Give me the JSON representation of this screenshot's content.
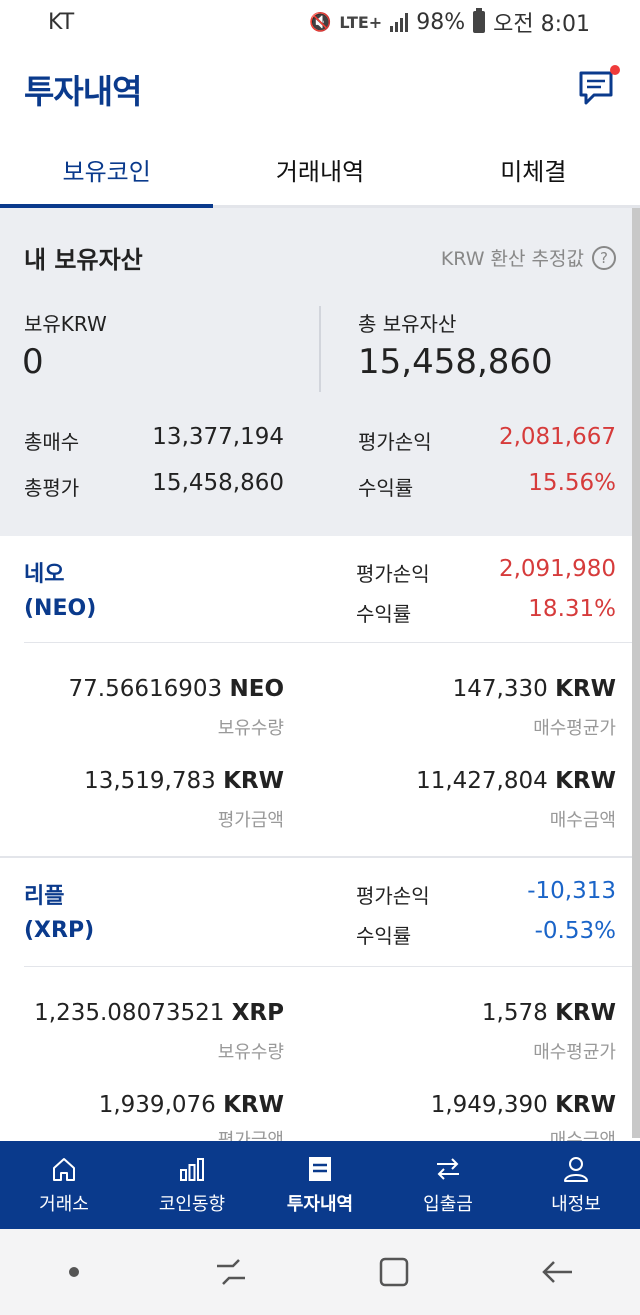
{
  "status": {
    "carrier": "KT",
    "network": "LTE+",
    "battery": "98%",
    "time": "오전 8:01"
  },
  "header": {
    "title": "투자내역"
  },
  "tabs": [
    {
      "label": "보유코인",
      "active": true
    },
    {
      "label": "거래내역",
      "active": false
    },
    {
      "label": "미체결",
      "active": false
    }
  ],
  "summary": {
    "title": "내 보유자산",
    "estimate_label": "KRW 환산 추정값",
    "help_glyph": "?",
    "krw_label": "보유KRW",
    "krw_value": "0",
    "total_label": "총 보유자산",
    "total_value": "15,458,860",
    "buy_label": "총매수",
    "buy_value": "13,377,194",
    "eval_label": "총평가",
    "eval_value": "15,458,860",
    "pl_label": "평가손익",
    "pl_value": "2,081,667",
    "rate_label": "수익률",
    "rate_value": "15.56%"
  },
  "coins": [
    {
      "name": "네오",
      "symbol": "(NEO)",
      "pl_label": "평가손익",
      "pl_value": "2,091,980",
      "rate_label": "수익률",
      "rate_value": "18.31%",
      "qty_value": "77.56616903",
      "qty_unit": "NEO",
      "qty_label": "보유수량",
      "avg_value": "147,330",
      "avg_unit": "KRW",
      "avg_label": "매수평균가",
      "eval_value": "13,519,783",
      "eval_unit": "KRW",
      "eval_label": "평가금액",
      "buy_value": "11,427,804",
      "buy_unit": "KRW",
      "buy_label": "매수금액"
    },
    {
      "name": "리플",
      "symbol": "(XRP)",
      "pl_label": "평가손익",
      "pl_value": "-10,313",
      "rate_label": "수익률",
      "rate_value": "-0.53%",
      "qty_value": "1,235.08073521",
      "qty_unit": "XRP",
      "qty_label": "보유수량",
      "avg_value": "1,578",
      "avg_unit": "KRW",
      "avg_label": "매수평균가",
      "eval_value": "1,939,076",
      "eval_unit": "KRW",
      "eval_label": "평가금액",
      "buy_value": "1,949,390",
      "buy_unit": "KRW",
      "buy_label": "매수금액"
    }
  ],
  "bottom_nav": [
    {
      "label": "거래소",
      "icon": "home-icon"
    },
    {
      "label": "코인동향",
      "icon": "bar-chart-icon"
    },
    {
      "label": "투자내역",
      "icon": "list-icon",
      "active": true
    },
    {
      "label": "입출금",
      "icon": "transfer-icon"
    },
    {
      "label": "내정보",
      "icon": "user-icon"
    }
  ],
  "colors": {
    "brand": "#0a3a8c",
    "profit": "#d63b3b",
    "loss": "#1a64c8",
    "summary_bg": "#eceef2"
  }
}
